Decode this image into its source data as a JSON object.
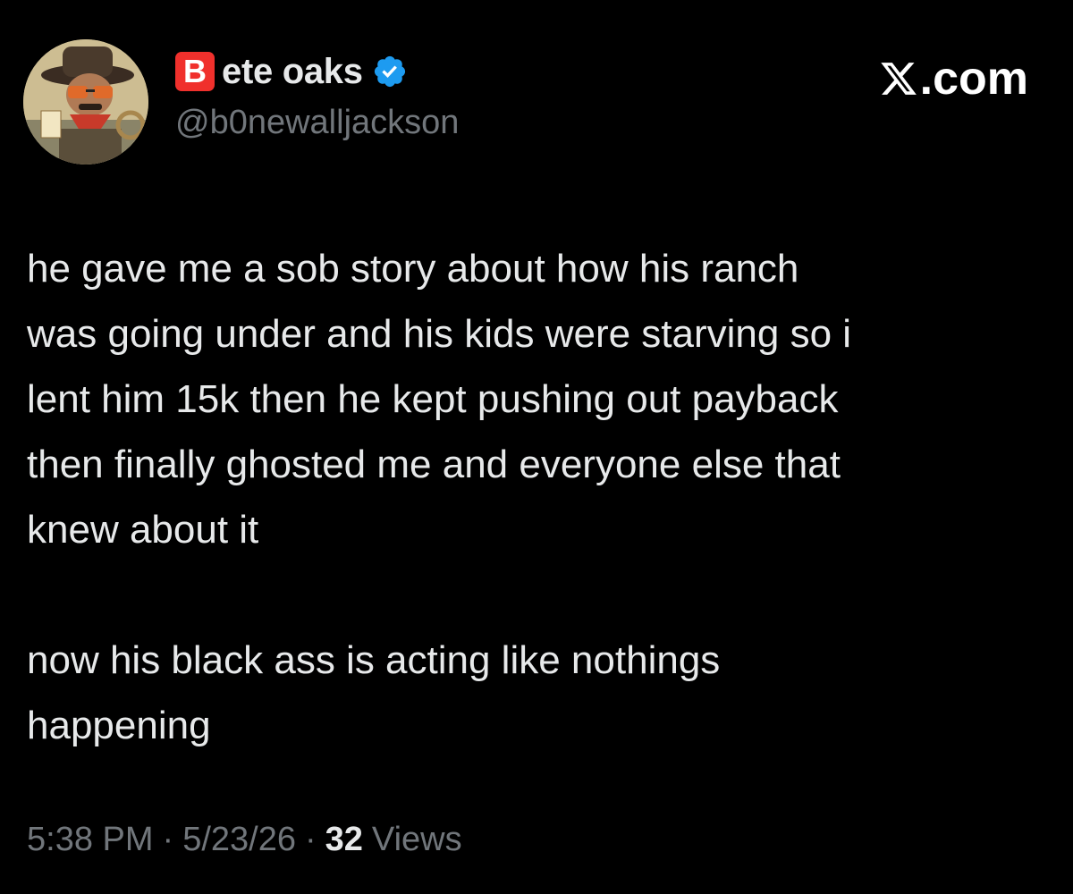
{
  "author": {
    "display_name": "ete oaks",
    "name_emoji": "B",
    "handle": "@b0newalljackson",
    "verified": true,
    "avatar": "avatar-image"
  },
  "brand": {
    "label": ".com",
    "icon": "x-logo-icon"
  },
  "tweet": {
    "text": "he gave me a sob story about how his ranch\nwas going under and his kids were starving so i\nlent him 15k then he kept pushing out payback\nthen finally ghosted me and everyone else that\nknew about it\n\nnow his black ass is acting like nothings\nhappening"
  },
  "meta": {
    "time": "5:38 PM",
    "separator": "·",
    "date": "5/23/26",
    "views_count": "32",
    "views_label": "Views"
  },
  "colors": {
    "background": "#000000",
    "primary_text": "#e7e9ea",
    "secondary_text": "#71767b",
    "verified_blue": "#1d9bf0",
    "emoji_red": "#f0302c"
  }
}
